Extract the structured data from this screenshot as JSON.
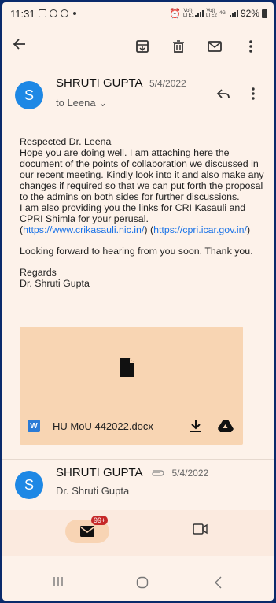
{
  "status_bar": {
    "time": "11:31",
    "network_label_1": "Vo))",
    "network_label_1b": "LTE1",
    "network_label_2": "Vo))",
    "network_label_2b": "LTE2",
    "net_type": "4G",
    "battery": "92%"
  },
  "toolbar": {
    "back_icon": "arrow-back-icon",
    "archive_icon": "archive-icon",
    "delete_icon": "delete-icon",
    "mark_unread_icon": "mail-icon",
    "more_icon": "more-vert-icon"
  },
  "message": {
    "avatar_letter": "S",
    "sender": "SHRUTI GUPTA",
    "date": "5/4/2022",
    "to_line": "to Leena",
    "body": {
      "greeting": "Respected Dr. Leena",
      "paragraph_1": "Hope you are doing well. I am attaching here the document of the points of collaboration we discussed in our recent meeting. Kindly look into it and also make any changes if required so that we can put forth the proposal to the admins on both sides for further discussions.",
      "paragraph_2": "I am also providing you the links for CRI Kasauli and CPRI Shimla for your perusal.",
      "link_1": "https://www.crikasauli.nic.in/",
      "link_2": "https://cpri.icar.gov.in/",
      "closing_line": "Looking forward to hearing from you soon. Thank you.",
      "regards": "Regards",
      "signature": "Dr. Shruti Gupta"
    },
    "attachment": {
      "type_badge": "W",
      "filename": "HU MoU 442022.docx"
    }
  },
  "second_message": {
    "avatar_letter": "S",
    "sender": "SHRUTI GUPTA",
    "date": "5/4/2022",
    "preview": "Dr. Shruti Gupta"
  },
  "bottom_nav": {
    "mail_badge": "99+"
  },
  "colors": {
    "accent_blue": "#1e88e5",
    "link": "#1a73e8",
    "background": "#fdf2ea",
    "attachment_bg": "#f8d5b3",
    "badge_red": "#c62828"
  }
}
